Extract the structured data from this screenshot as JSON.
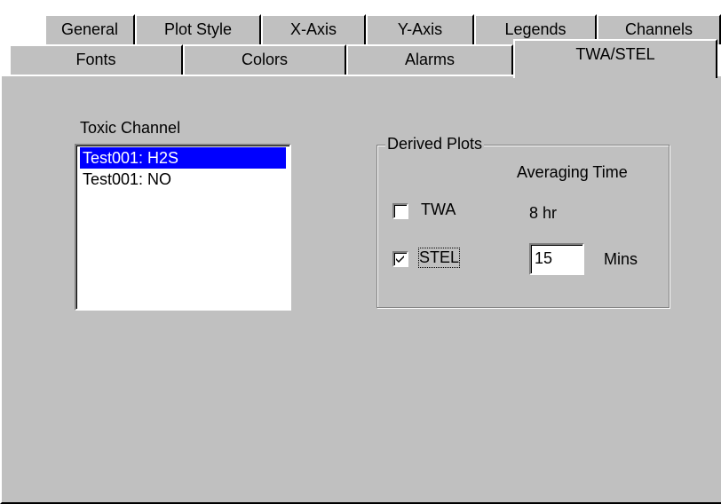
{
  "tabs_back_row": [
    {
      "label": "General"
    },
    {
      "label": "Plot Style"
    },
    {
      "label": "X-Axis"
    },
    {
      "label": "Y-Axis"
    },
    {
      "label": "Legends"
    },
    {
      "label": "Channels"
    }
  ],
  "tabs_front_row": [
    {
      "label": "Fonts"
    },
    {
      "label": "Colors"
    },
    {
      "label": "Alarms"
    },
    {
      "label": "TWA/STEL",
      "selected": true
    }
  ],
  "toxic_channel": {
    "label": "Toxic Channel",
    "items": [
      {
        "label": "Test001: H2S",
        "selected": true
      },
      {
        "label": "Test001:  NO",
        "selected": false
      }
    ]
  },
  "derived_plots": {
    "legend": "Derived Plots",
    "averaging_time_header": "Averaging Time",
    "twa": {
      "label": "TWA",
      "checked": false,
      "value": "8 hr"
    },
    "stel": {
      "label": "STEL",
      "checked": true,
      "value": "15",
      "unit": "Mins"
    }
  },
  "colors": {
    "face": "#c0c0c0",
    "highlight": "#ffffff",
    "shadow": "#808080",
    "selection": "#0000ff"
  }
}
